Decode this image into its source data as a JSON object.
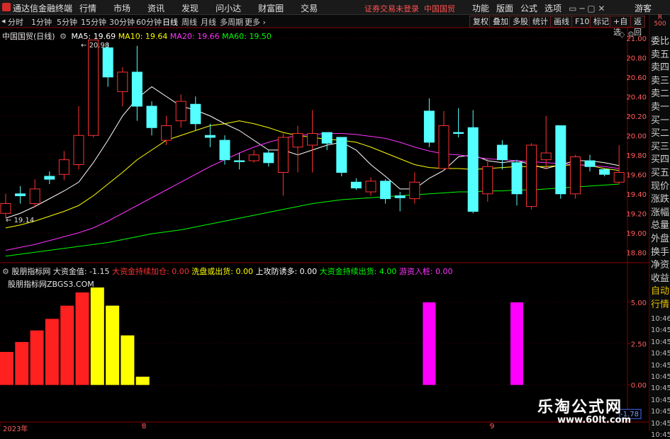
{
  "titlebar": {
    "app_name": "通达信金融终端",
    "menu": [
      "行情",
      "市场",
      "资讯",
      "发现",
      "问小达",
      "财富圈",
      "交易"
    ],
    "notice": "证券交易未登录",
    "stock": "中国国贸",
    "right_menu": [
      "功能",
      "版面",
      "公式",
      "选项"
    ],
    "guest": "游客"
  },
  "periodbar": {
    "periods": [
      "分时",
      "1分钟",
      "5分钟",
      "15分钟",
      "30分钟",
      "60分钟",
      "日线",
      "周线",
      "月线",
      "多周期",
      "更多"
    ],
    "active": "日线",
    "tools": [
      "复权",
      "叠加",
      "多股",
      "统计",
      "画线",
      "F10",
      "标记",
      "+自选",
      "返回"
    ],
    "badge": "R 500"
  },
  "main_chart": {
    "stock_label": "中国国贸(日线)",
    "ma": [
      {
        "name": "MA5",
        "value": "19.69",
        "color": "#ffffff"
      },
      {
        "name": "MA10",
        "value": "19.64",
        "color": "#ffff00"
      },
      {
        "name": "MA20",
        "value": "19.66",
        "color": "#ff33ff"
      },
      {
        "name": "MA60",
        "value": "19.50",
        "color": "#00ff00"
      }
    ],
    "high_label": "20.98",
    "low_label": "19.14",
    "axis_ticks": [
      "21.00",
      "20.80",
      "20.60",
      "20.40",
      "20.20",
      "20.00",
      "19.80",
      "19.60",
      "19.40",
      "19.20",
      "19.00",
      "18.80"
    ]
  },
  "indicator": {
    "name": "股朋指标网",
    "items": [
      {
        "label": "大资金值",
        "value": "-1.15",
        "color": "#e0e0e0"
      },
      {
        "label": "大资金持续加仓",
        "value": "0.00",
        "color": "#ff3030"
      },
      {
        "label": "洗盘或出货",
        "value": "0.00",
        "color": "#ffff00"
      },
      {
        "label": "上攻防诱多",
        "value": "0.00",
        "color": "#ffffff"
      },
      {
        "label": "大资金持续出货",
        "value": "4.00",
        "color": "#00ff00"
      },
      {
        "label": "游资入桩",
        "value": "0.00",
        "color": "#ff33ff"
      }
    ],
    "site_label": "股朋指标网ZBGS3.COM",
    "axis_ticks": [
      "5.00",
      "2.50",
      "0.00"
    ],
    "current_value": "-1.78"
  },
  "xaxis": {
    "labels": [
      "2023年",
      "8",
      "9"
    ]
  },
  "right_panel": {
    "items": [
      "委比",
      "卖五",
      "卖四",
      "卖三",
      "卖二",
      "卖一",
      "买一",
      "买二",
      "买三",
      "买四",
      "买五",
      "现价",
      "涨跌",
      "涨幅",
      "总量",
      "外盘",
      "换手",
      "净资",
      "收益",
      "自动",
      "行情"
    ],
    "times": [
      "10:46",
      "10:45",
      "10:45",
      "10:45",
      "10:45",
      "10:45",
      "10:45",
      "10:45",
      "10:45",
      "10:45",
      "10:45"
    ]
  },
  "watermark": {
    "title": "乐淘公式网",
    "url": "www.60lt.com"
  },
  "chart_data": {
    "type": "candlestick",
    "ylim": [
      18.7,
      21.1
    ],
    "candles": [
      {
        "o": 19.2,
        "c": 19.3,
        "h": 19.4,
        "l": 19.15
      },
      {
        "o": 19.4,
        "c": 19.38,
        "h": 19.48,
        "l": 19.3
      },
      {
        "o": 19.3,
        "c": 19.45,
        "h": 19.55,
        "l": 19.26
      },
      {
        "o": 19.58,
        "c": 19.55,
        "h": 19.63,
        "l": 19.5
      },
      {
        "o": 19.6,
        "c": 19.75,
        "h": 19.84,
        "l": 19.54
      },
      {
        "o": 19.7,
        "c": 20.0,
        "h": 20.3,
        "l": 19.65
      },
      {
        "o": 20.0,
        "c": 20.98,
        "h": 20.98,
        "l": 19.98
      },
      {
        "o": 20.9,
        "c": 20.6,
        "h": 20.95,
        "l": 20.5
      },
      {
        "o": 20.45,
        "c": 20.65,
        "h": 20.7,
        "l": 20.3
      },
      {
        "o": 20.65,
        "c": 20.3,
        "h": 20.92,
        "l": 20.15
      },
      {
        "o": 20.3,
        "c": 20.08,
        "h": 20.35,
        "l": 20.0
      },
      {
        "o": 19.95,
        "c": 20.1,
        "h": 20.2,
        "l": 19.9
      },
      {
        "o": 20.15,
        "c": 20.35,
        "h": 20.42,
        "l": 20.08
      },
      {
        "o": 20.32,
        "c": 20.12,
        "h": 20.4,
        "l": 20.05
      },
      {
        "o": 20.0,
        "c": 19.98,
        "h": 20.12,
        "l": 19.88
      },
      {
        "o": 19.95,
        "c": 19.75,
        "h": 20.0,
        "l": 19.7
      },
      {
        "o": 19.74,
        "c": 19.73,
        "h": 19.82,
        "l": 19.65
      },
      {
        "o": 19.74,
        "c": 19.8,
        "h": 19.85,
        "l": 19.72
      },
      {
        "o": 19.82,
        "c": 19.72,
        "h": 19.85,
        "l": 19.68
      },
      {
        "o": 19.62,
        "c": 19.98,
        "h": 20.02,
        "l": 19.38
      },
      {
        "o": 19.88,
        "c": 20.02,
        "h": 20.1,
        "l": 19.62
      },
      {
        "o": 19.9,
        "c": 20.02,
        "h": 20.26,
        "l": 19.62
      },
      {
        "o": 20.03,
        "c": 19.92,
        "h": 20.03,
        "l": 19.85
      },
      {
        "o": 19.98,
        "c": 19.62,
        "h": 19.98,
        "l": 19.58
      },
      {
        "o": 19.52,
        "c": 19.46,
        "h": 19.56,
        "l": 19.44
      },
      {
        "o": 19.42,
        "c": 19.53,
        "h": 19.57,
        "l": 19.38
      },
      {
        "o": 19.53,
        "c": 19.35,
        "h": 19.55,
        "l": 19.3
      },
      {
        "o": 19.38,
        "c": 19.36,
        "h": 19.42,
        "l": 19.22
      },
      {
        "o": 19.35,
        "c": 19.52,
        "h": 19.62,
        "l": 19.3
      },
      {
        "o": 20.25,
        "c": 19.93,
        "h": 20.38,
        "l": 19.88
      },
      {
        "o": 19.66,
        "c": 20.1,
        "h": 20.25,
        "l": 19.64
      },
      {
        "o": 20.03,
        "c": 20.02,
        "h": 20.28,
        "l": 19.98
      },
      {
        "o": 20.08,
        "c": 19.22,
        "h": 20.26,
        "l": 19.2
      },
      {
        "o": 19.4,
        "c": 19.68,
        "h": 19.76,
        "l": 19.32
      },
      {
        "o": 19.9,
        "c": 19.75,
        "h": 19.95,
        "l": 19.65
      },
      {
        "o": 19.72,
        "c": 19.4,
        "h": 19.75,
        "l": 19.28
      },
      {
        "o": 19.27,
        "c": 19.9,
        "h": 19.92,
        "l": 19.24
      },
      {
        "o": 19.75,
        "c": 19.82,
        "h": 20.2,
        "l": 19.65
      },
      {
        "o": 20.1,
        "c": 19.4,
        "h": 20.1,
        "l": 19.35
      },
      {
        "o": 19.4,
        "c": 19.78,
        "h": 19.8,
        "l": 19.35
      },
      {
        "o": 19.74,
        "c": 19.68,
        "h": 19.8,
        "l": 19.63
      },
      {
        "o": 19.65,
        "c": 19.6,
        "h": 19.66,
        "l": 19.58
      },
      {
        "o": 19.52,
        "c": 19.62,
        "h": 19.9,
        "l": 19.5
      }
    ],
    "ma_series": [
      {
        "name": "MA5",
        "color": "#ffffff",
        "values": [
          19.15,
          19.2,
          19.27,
          19.35,
          19.43,
          19.52,
          19.72,
          19.95,
          20.2,
          20.38,
          20.5,
          20.4,
          20.3,
          20.26,
          20.2,
          20.12,
          20.05,
          19.95,
          19.85,
          19.85,
          19.8,
          19.85,
          19.9,
          19.93,
          19.85,
          19.7,
          19.58,
          19.45,
          19.45,
          19.56,
          19.64,
          19.78,
          19.8,
          19.74,
          19.72,
          19.74,
          19.7,
          19.66,
          19.7,
          19.74,
          19.74,
          19.72,
          19.69
        ]
      },
      {
        "name": "MA10",
        "color": "#ffff00",
        "values": [
          19.05,
          19.08,
          19.12,
          19.17,
          19.22,
          19.28,
          19.38,
          19.5,
          19.62,
          19.75,
          19.85,
          19.95,
          20.0,
          20.05,
          20.1,
          20.12,
          20.15,
          20.12,
          20.08,
          20.03,
          20.0,
          19.98,
          19.96,
          19.95,
          19.93,
          19.88,
          19.82,
          19.76,
          19.7,
          19.67,
          19.66,
          19.66,
          19.65,
          19.66,
          19.67,
          19.68,
          19.68,
          19.68,
          19.69,
          19.7,
          19.69,
          19.66,
          19.64
        ]
      },
      {
        "name": "MA20",
        "color": "#ff33ff",
        "values": [
          18.82,
          18.85,
          18.88,
          18.92,
          18.96,
          19.0,
          19.05,
          19.12,
          19.2,
          19.28,
          19.36,
          19.44,
          19.52,
          19.6,
          19.68,
          19.75,
          19.82,
          19.88,
          19.93,
          19.97,
          20.0,
          20.01,
          20.02,
          20.02,
          20.01,
          19.99,
          19.97,
          19.93,
          19.88,
          19.84,
          19.81,
          19.8,
          19.78,
          19.76,
          19.75,
          19.74,
          19.73,
          19.72,
          19.71,
          19.7,
          19.69,
          19.68,
          19.66
        ]
      },
      {
        "name": "MA60",
        "color": "#00ff00",
        "values": [
          18.76,
          18.78,
          18.8,
          18.82,
          18.84,
          18.86,
          18.88,
          18.9,
          18.93,
          18.96,
          18.99,
          19.01,
          19.03,
          19.06,
          19.09,
          19.12,
          19.15,
          19.18,
          19.21,
          19.24,
          19.27,
          19.3,
          19.32,
          19.34,
          19.35,
          19.36,
          19.37,
          19.38,
          19.39,
          19.4,
          19.41,
          19.42,
          19.42,
          19.43,
          19.43,
          19.44,
          19.44,
          19.45,
          19.46,
          19.47,
          19.48,
          19.49,
          19.5
        ]
      }
    ],
    "indicator_ylim": [
      -2.2,
      6.5
    ],
    "indicator_bars": [
      {
        "index": 0,
        "value": 2.0,
        "color": "#ff2020"
      },
      {
        "index": 1,
        "value": 2.6,
        "color": "#ff2020"
      },
      {
        "index": 2,
        "value": 3.3,
        "color": "#ff2020"
      },
      {
        "index": 3,
        "value": 4.0,
        "color": "#ff2020"
      },
      {
        "index": 4,
        "value": 4.8,
        "color": "#ff2020"
      },
      {
        "index": 5,
        "value": 5.6,
        "color": "#ff2020"
      },
      {
        "index": 6,
        "value": 5.9,
        "color": "#ffff00"
      },
      {
        "index": 7,
        "value": 4.8,
        "color": "#ffff00"
      },
      {
        "index": 8,
        "value": 3.0,
        "color": "#ffff00"
      },
      {
        "index": 9,
        "value": 0.5,
        "color": "#ffff00"
      },
      {
        "index": 29,
        "value": 5.0,
        "color": "#ff00ff"
      },
      {
        "index": 35,
        "value": 5.0,
        "color": "#ff00ff"
      }
    ]
  }
}
